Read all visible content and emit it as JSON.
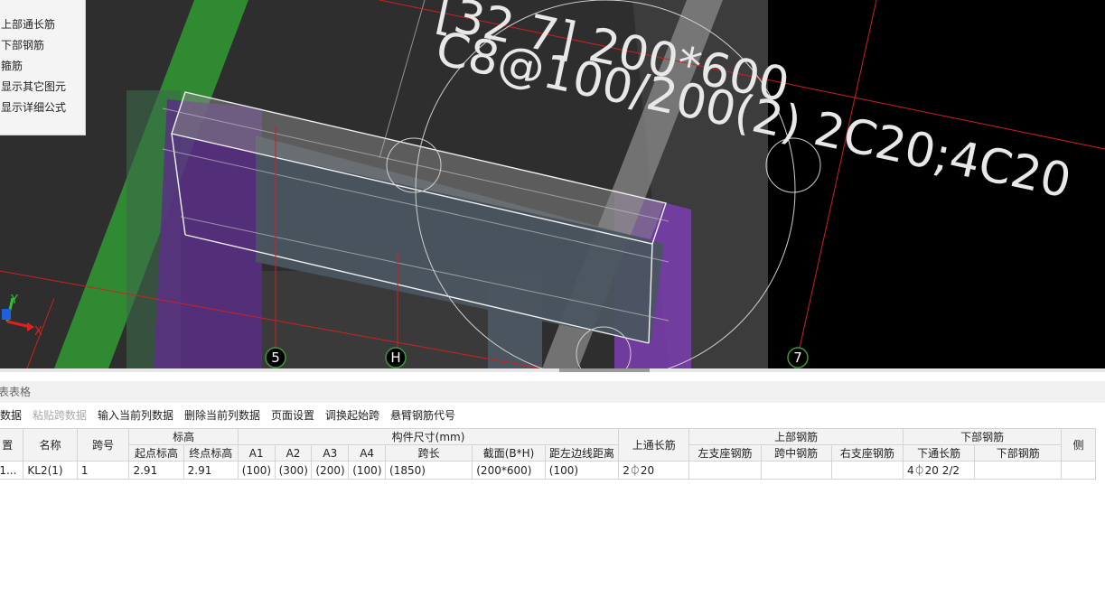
{
  "viewport": {
    "annotation_line1": "[32 7] 200*600",
    "annotation_line2": "C8@100/200(2) 2C20;4C20",
    "grid_labels": [
      "5",
      "H",
      "7"
    ],
    "axis": {
      "y": "Y",
      "x": "X"
    },
    "colors": {
      "background": "#2e2e2e",
      "column_green": "#2f8a32",
      "support_purple": "#6a3a9c",
      "beam_fill": "#4a5560",
      "axis_line": "#d02020"
    }
  },
  "layer_panel": {
    "items": [
      "上部通长筋",
      "下部钢筋",
      "箍筋",
      "显示其它图元",
      "显示详细公式"
    ]
  },
  "table_panel": {
    "title": "表表格",
    "toolbar": [
      {
        "label": "数据",
        "disabled": false
      },
      {
        "label": "粘贴跨数据",
        "disabled": true
      },
      {
        "label": "输入当前列数据",
        "disabled": false
      },
      {
        "label": "删除当前列数据",
        "disabled": false
      },
      {
        "label": "页面设置",
        "disabled": false
      },
      {
        "label": "调换起始跨",
        "disabled": false
      },
      {
        "label": "悬臂钢筋代号",
        "disabled": false
      }
    ],
    "header_top": {
      "position": "置",
      "name": "名称",
      "span": "跨号",
      "elevation": "标高",
      "dimensions": "构件尺寸(mm)",
      "top_continuous": "上通长筋",
      "top_rebar": "上部钢筋",
      "bottom_rebar": "下部钢筋",
      "side": "侧"
    },
    "header_sub": {
      "start_elev": "起点标高",
      "end_elev": "终点标高",
      "a1": "A1",
      "a2": "A2",
      "a3": "A3",
      "a4": "A4",
      "span_len": "跨长",
      "section": "截面(B*H)",
      "dist_left": "距左边线距离",
      "left_support": "左支座钢筋",
      "mid_span": "跨中钢筋",
      "right_support": "右支座钢筋",
      "bottom_continuous": "下通长筋",
      "bottom_rebar": "下部钢筋"
    },
    "rows": [
      {
        "position": "-1...",
        "name": "KL2(1)",
        "span": "1",
        "start_elev": "2.91",
        "end_elev": "2.91",
        "a1": "(100)",
        "a2": "(300)",
        "a3": "(200)",
        "a4": "(100)",
        "span_len": "(1850)",
        "section": "(200*600)",
        "dist_left": "(100)",
        "top_continuous": "2⏀20",
        "left_support": "",
        "mid_span": "",
        "right_support": "",
        "bottom_continuous": "4⏀20 2/2",
        "bottom_rebar": "",
        "side": ""
      }
    ]
  }
}
